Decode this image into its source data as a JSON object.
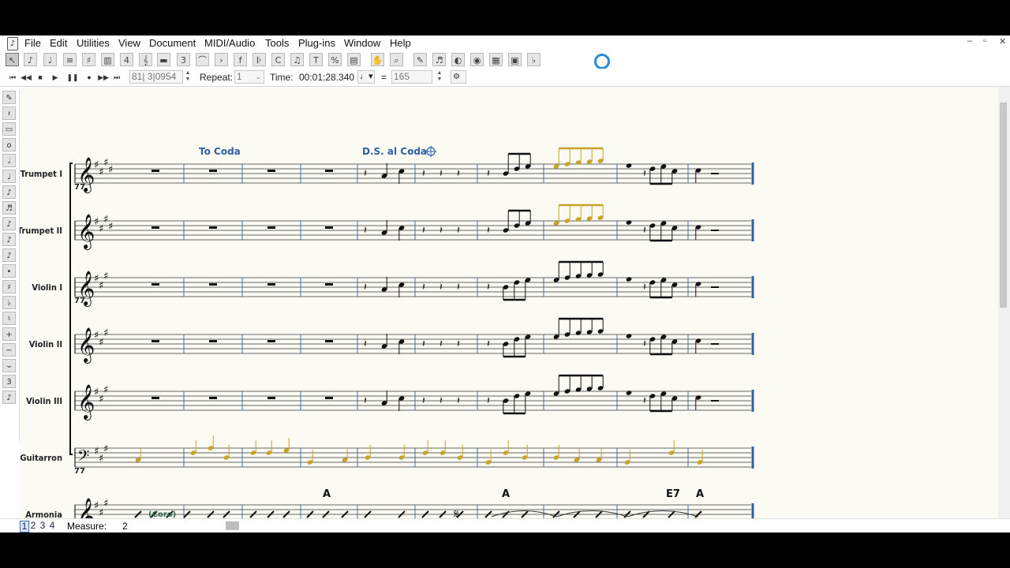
{
  "menu": {
    "items": [
      "File",
      "Edit",
      "Utilities",
      "View",
      "Document",
      "MIDI/Audio",
      "Tools",
      "Plug-ins",
      "Window",
      "Help"
    ],
    "window_buttons": [
      "–",
      "▫",
      "✕"
    ]
  },
  "playback": {
    "counter": "81| 3|0954",
    "repeat_label": "Repeat:",
    "repeat_value": "1",
    "time_label": "Time:",
    "time_value": "00:01:28.340",
    "tempo_equals": "=",
    "tempo_value": "165"
  },
  "score": {
    "markings": {
      "to_coda": "To Coda",
      "ds_al_coda": "D.S. al Coda"
    },
    "measure_number": "77",
    "instruments": [
      "Trumpet I",
      "Trumpet II",
      "Violin I",
      "Violin II",
      "Violin III",
      "Guitarron",
      "Armonia"
    ],
    "chord_symbols": [
      "A",
      "A",
      "E7",
      "A"
    ],
    "bottom_label": "(Coro)"
  },
  "status_bar": {
    "pages": [
      "1",
      "2",
      "3",
      "4"
    ],
    "selected_page": "1",
    "measure_label": "Measure:",
    "measure_value": "2"
  },
  "colors": {
    "highlight_note": "#c9a227",
    "barline": "#2f5fa5",
    "paper": "#fbfbf4",
    "spinner": "#2a8bd8"
  }
}
